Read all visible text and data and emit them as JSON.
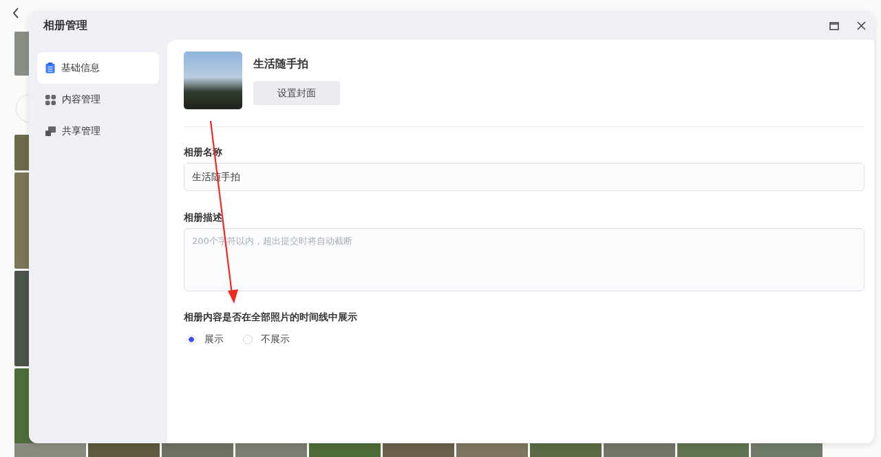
{
  "dialog": {
    "title": "相册管理"
  },
  "sidebar": {
    "items": [
      {
        "label": "基础信息",
        "kind": "clipboard",
        "selected": true
      },
      {
        "label": "内容管理",
        "kind": "grid",
        "selected": false
      },
      {
        "label": "共享管理",
        "kind": "share",
        "selected": false
      }
    ]
  },
  "album": {
    "name": "生活随手拍",
    "cover_button": "设置封面"
  },
  "form": {
    "name_label": "相册名称",
    "name_value": "生活随手拍",
    "description_label": "相册描述",
    "description_placeholder": "200个字符以内，超出提交时将自动截断",
    "timeline_label": "相册内容是否在全部照片的时间线中展示",
    "options": [
      {
        "label": "展示",
        "selected": true
      },
      {
        "label": "不展示",
        "selected": false
      }
    ]
  }
}
